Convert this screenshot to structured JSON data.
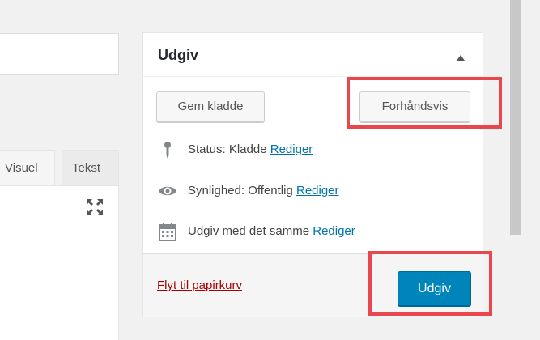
{
  "editor": {
    "tabs": [
      {
        "label": "Visuel"
      },
      {
        "label": "Tekst"
      }
    ],
    "fullscreen_icon": "fullscreen-icon"
  },
  "publish_box": {
    "title": "Udgiv",
    "toggle_icon": "triangle-up-icon",
    "save_draft_label": "Gem kladde",
    "preview_label": "Forhåndsvis",
    "status": {
      "icon": "pin-icon",
      "text": "Status: Kladde",
      "edit_label": "Rediger"
    },
    "visibility": {
      "icon": "eye-icon",
      "text": "Synlighed: Offentlig",
      "edit_label": "Rediger"
    },
    "schedule": {
      "icon": "calendar-icon",
      "text": "Udgiv med det samme",
      "edit_label": "Rediger"
    },
    "trash_label": "Flyt til papirkurv",
    "publish_label": "Udgiv"
  },
  "colors": {
    "accent": "#0085ba",
    "link": "#0073aa",
    "trash": "#a00000",
    "callout": "#e8474d"
  }
}
